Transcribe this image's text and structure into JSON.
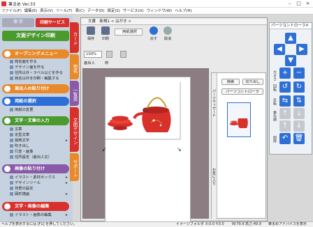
{
  "window": {
    "title": "筆まめ Ver.33"
  },
  "menu": [
    "ファイル(F)",
    "編集(E)",
    "表示(V)",
    "ツール(T)",
    "表(C)",
    "データ(D)",
    "設定(S)",
    "サービス(U)",
    "ウィンドウ(W)",
    "ヘルプ(H)"
  ],
  "left": {
    "save_label": "保 存",
    "print_service_label": "印刷サービス",
    "doc_design_print": "文面デザイン印刷",
    "opening_menu": "オープニングメニュー",
    "opening_items": [
      "宛名面を作る",
      "デザイン面を作る",
      "住所以外・ラベル以どを作る",
      "宛名以外を印刷・編集する"
    ],
    "pattern_paste": "差出人の貼り付け",
    "paper_select": "用紙の選択",
    "paper_select_items": [
      "用紙の変更"
    ],
    "text_input": "文字・文章の入力",
    "text_items": [
      "文章",
      "定型文章",
      "装飾文字",
      "吹き出し",
      "行変・画像",
      "住所設定（差出人文）"
    ],
    "image_paste": "画像の貼り付け",
    "image_items": [
      "イラスト・素材ボックス",
      "デザインツール",
      "背景の設定",
      "図形描画"
    ],
    "text_image_edit": "文字・画像の編集",
    "text_image_edit_items": [
      "イラスト・画像の編集"
    ]
  },
  "tabs": {
    "card": "カード",
    "atena": "宛名",
    "ichiran": "一覧表",
    "bunmen": "文面デザイン",
    "support": "サポート"
  },
  "doc": {
    "title": "文書　新規1 < はがき >",
    "toolbar": [
      "保存",
      "印刷",
      "用紙選択",
      "戻す",
      "取消"
    ],
    "zoom": "100%",
    "tools": [
      "差出人",
      "枠"
    ]
  },
  "props": {
    "tabs": [
      "パーツウィザード",
      "お気に入り"
    ],
    "search_btn": "検索",
    "cutout_btn": "切り出し",
    "parts_ctrl_btn": "パーツコントローラ"
  },
  "parts": {
    "title": "パーツコントローラ",
    "labels": [
      "大きさ",
      "回転",
      "反転",
      "重ね順",
      "削除"
    ]
  },
  "status": {
    "left": "ヘルプを表示するには [F1] を押してください。",
    "mid": "イメージフォルダ",
    "coords": "X:0.0 Y:0.0",
    "size": "W:79.9 高さ:49.9",
    "advice": "筆まめアドバイスを表示"
  },
  "colors": {
    "red": "#d8302a",
    "green": "#4a9a2e",
    "orange": "#e8892a",
    "blue": "#2e6fd6",
    "purple": "#8a5aa8"
  }
}
